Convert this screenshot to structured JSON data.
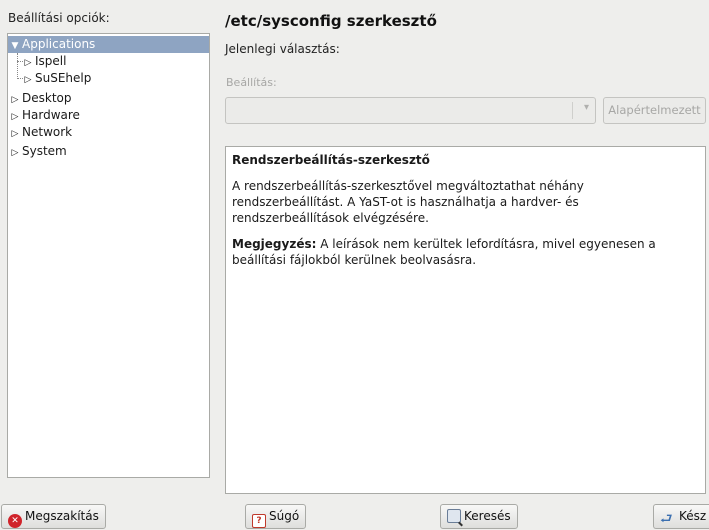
{
  "left_panel": {
    "label": "Beállítási opciók:",
    "label_accel_char": "e",
    "tree": [
      {
        "label": "Applications",
        "expanded": true,
        "selected": true,
        "level": 0
      },
      {
        "label": "Ispell",
        "expanded": false,
        "selected": false,
        "level": 1
      },
      {
        "label": "SuSEhelp",
        "expanded": false,
        "selected": false,
        "level": 1
      },
      {
        "label": "Desktop",
        "expanded": false,
        "selected": false,
        "level": 0
      },
      {
        "label": "Hardware",
        "expanded": false,
        "selected": false,
        "level": 0
      },
      {
        "label": "Network",
        "expanded": false,
        "selected": false,
        "level": 0
      },
      {
        "label": "System",
        "expanded": false,
        "selected": false,
        "level": 0
      }
    ]
  },
  "right_panel": {
    "title": "/etc/sysconfig szerkesztő",
    "current_selection_label": "Jelenlegi választás:",
    "setting_label": "Beállítás:",
    "setting_value": "",
    "default_button": "Alapértelmezett",
    "description": {
      "title": "Rendszerbeállítás-szerkesztő",
      "paragraph1": " A rendszerbeállítás-szerkesztővel megváltoztathat néhány rendszerbeállítást. A YaST-ot is használhatja a hardver- és rendszerbeállítások elvégzésére.",
      "note_label": "Megjegyzés:",
      "note_text": " A leírások nem kerültek lefordításra, mivel egyenesen a beállítási fájlokból kerülnek beolvasásra."
    }
  },
  "buttons": {
    "cancel": "Megszakítás",
    "help": "Súgó",
    "search": "Keresés",
    "finish": "Kész"
  },
  "icons": {
    "cancel": "cancel-icon",
    "help": "help-icon",
    "search": "search-icon",
    "finish": "finish-icon",
    "expanded": "triangle-down-icon",
    "collapsed": "triangle-right-icon",
    "combo": "chevron-down-icon"
  },
  "colors": {
    "selection": "#8ea4c2",
    "background": "#eeeeec",
    "cancel_icon": "#d0232a"
  }
}
